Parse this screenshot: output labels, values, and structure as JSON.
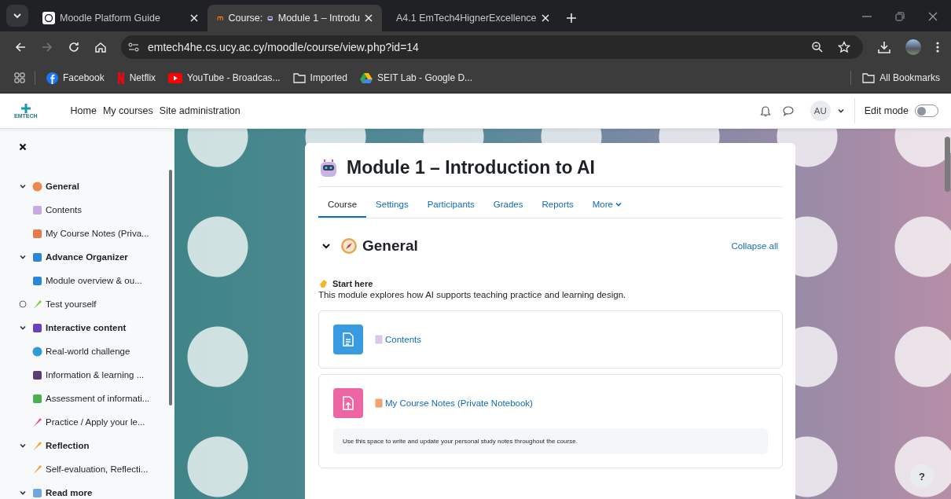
{
  "browser": {
    "tabs": [
      {
        "title": "Moodle Platform Guide",
        "selected": false,
        "kind": "guide"
      },
      {
        "title": "Course:",
        "title_rest": "Module 1 – Introdu",
        "selected": true,
        "kind": "moodle"
      },
      {
        "title": "A4.1 EmTech4HignerExcellence",
        "selected": false,
        "kind": "docs"
      }
    ],
    "address": "emtech4he.cs.ucy.ac.cy/moodle/course/view.php?id=14",
    "bookmarks": [
      {
        "label": "Facebook",
        "kind": "facebook"
      },
      {
        "label": "Netflix",
        "kind": "netflix"
      },
      {
        "label": "YouTube - Broadcas...",
        "kind": "youtube"
      },
      {
        "label": "Imported",
        "kind": "folder"
      },
      {
        "label": "SEIT Lab - Google D...",
        "kind": "drive"
      }
    ],
    "all_bookmarks": "All Bookmarks"
  },
  "navbar": {
    "logo": "EMTECH",
    "links": [
      "Home",
      "My courses",
      "Site administration"
    ],
    "avatar": "AU",
    "edit_mode": {
      "label": "Edit mode",
      "on": false
    }
  },
  "course_index": {
    "sections": [
      {
        "title": "General",
        "expanded": true,
        "children": [
          {
            "title": "Contents",
            "kind": "activity"
          },
          {
            "title": "My Course Notes (Priva...",
            "kind": "activity"
          }
        ]
      },
      {
        "title": "Advance Organizer",
        "expanded": true,
        "children": [
          {
            "title": "Module overview & ou...",
            "kind": "activity"
          },
          {
            "title": "Test yourself",
            "kind": "tracked"
          }
        ]
      },
      {
        "title": "Interactive content",
        "expanded": true,
        "children": [
          {
            "title": "Real-world challenge",
            "kind": "activity"
          },
          {
            "title": "Information & learning ...",
            "kind": "activity"
          },
          {
            "title": "Assessment of informati...",
            "kind": "activity"
          },
          {
            "title": "Practice / Apply your le...",
            "kind": "activity"
          }
        ]
      },
      {
        "title": "Reflection",
        "expanded": true,
        "children": [
          {
            "title": "Self-evaluation, Reflecti...",
            "kind": "activity"
          }
        ]
      },
      {
        "title": "Read more",
        "expanded": true
      }
    ]
  },
  "course": {
    "title": "Module 1 – Introduction to AI",
    "tabs": [
      {
        "label": "Course",
        "selected": true
      },
      {
        "label": "Settings",
        "selected": false
      },
      {
        "label": "Participants",
        "selected": false
      },
      {
        "label": "Grades",
        "selected": false
      },
      {
        "label": "Reports",
        "selected": false
      },
      {
        "label": "More",
        "selected": false
      }
    ],
    "section": {
      "title": "General",
      "expanded": true,
      "collapse_all": "Collapse all",
      "intro_heading": "Start here",
      "intro_text": "This module explores how AI supports teaching practice and learning design.",
      "activities": [
        {
          "title": "Contents",
          "kind": "page"
        },
        {
          "title": "My Course Notes (Private Notebook)",
          "kind": "assignment",
          "description": "Use this space to write and update your personal study notes throughout the course."
        }
      ]
    }
  },
  "help": "?"
}
